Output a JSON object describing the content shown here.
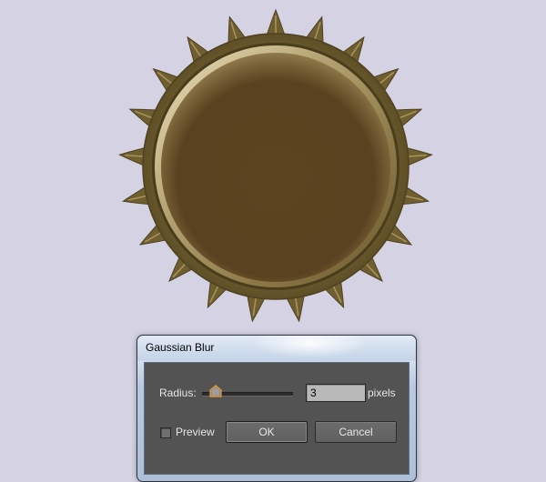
{
  "dialog": {
    "title": "Gaussian Blur",
    "radius_label": "Radius:",
    "radius_value": "3",
    "radius_slider_fraction": 0.15,
    "unit_label": "pixels",
    "preview_label": "Preview",
    "preview_checked": false,
    "ok_label": "OK",
    "cancel_label": "Cancel"
  },
  "colors": {
    "canvas_background": "#d5d3e3",
    "cap_metal": "#6e5d30",
    "cap_face": "#5b4220",
    "dialog_body": "#535353"
  }
}
